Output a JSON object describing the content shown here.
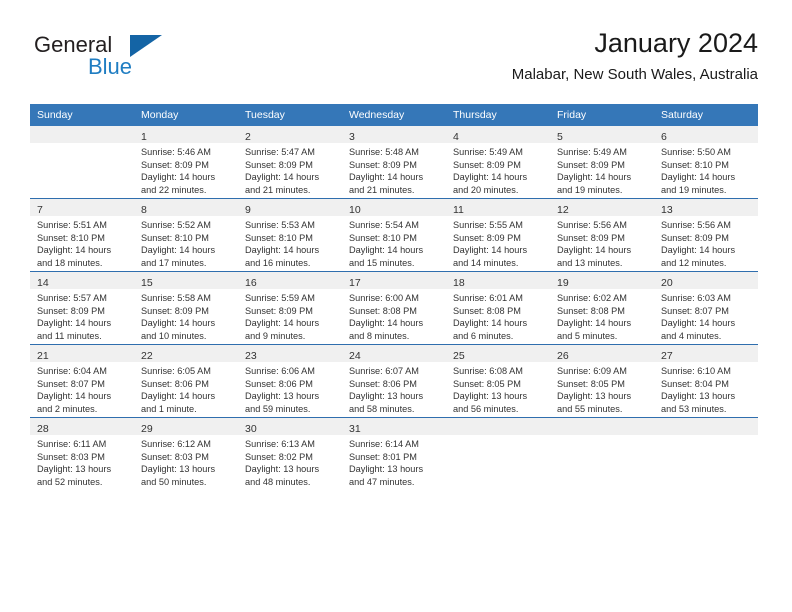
{
  "brand": {
    "word_general": "General",
    "word_blue": "Blue",
    "triangle_color": "#1464a5"
  },
  "header": {
    "title": "January 2024",
    "subtitle": "Malabar, New South Wales, Australia"
  },
  "theme": {
    "header_bg": "#3577b8",
    "daynum_bg": "#f0f0f0",
    "row_divider": "#2f6eae",
    "text": "#333333"
  },
  "weekdays": [
    "Sunday",
    "Monday",
    "Tuesday",
    "Wednesday",
    "Thursday",
    "Friday",
    "Saturday"
  ],
  "weeks": [
    [
      {
        "day": "",
        "sunrise": "",
        "sunset": "",
        "daylight1": "",
        "daylight2": ""
      },
      {
        "day": "1",
        "sunrise": "Sunrise: 5:46 AM",
        "sunset": "Sunset: 8:09 PM",
        "daylight1": "Daylight: 14 hours",
        "daylight2": "and 22 minutes."
      },
      {
        "day": "2",
        "sunrise": "Sunrise: 5:47 AM",
        "sunset": "Sunset: 8:09 PM",
        "daylight1": "Daylight: 14 hours",
        "daylight2": "and 21 minutes."
      },
      {
        "day": "3",
        "sunrise": "Sunrise: 5:48 AM",
        "sunset": "Sunset: 8:09 PM",
        "daylight1": "Daylight: 14 hours",
        "daylight2": "and 21 minutes."
      },
      {
        "day": "4",
        "sunrise": "Sunrise: 5:49 AM",
        "sunset": "Sunset: 8:09 PM",
        "daylight1": "Daylight: 14 hours",
        "daylight2": "and 20 minutes."
      },
      {
        "day": "5",
        "sunrise": "Sunrise: 5:49 AM",
        "sunset": "Sunset: 8:09 PM",
        "daylight1": "Daylight: 14 hours",
        "daylight2": "and 19 minutes."
      },
      {
        "day": "6",
        "sunrise": "Sunrise: 5:50 AM",
        "sunset": "Sunset: 8:10 PM",
        "daylight1": "Daylight: 14 hours",
        "daylight2": "and 19 minutes."
      }
    ],
    [
      {
        "day": "7",
        "sunrise": "Sunrise: 5:51 AM",
        "sunset": "Sunset: 8:10 PM",
        "daylight1": "Daylight: 14 hours",
        "daylight2": "and 18 minutes."
      },
      {
        "day": "8",
        "sunrise": "Sunrise: 5:52 AM",
        "sunset": "Sunset: 8:10 PM",
        "daylight1": "Daylight: 14 hours",
        "daylight2": "and 17 minutes."
      },
      {
        "day": "9",
        "sunrise": "Sunrise: 5:53 AM",
        "sunset": "Sunset: 8:10 PM",
        "daylight1": "Daylight: 14 hours",
        "daylight2": "and 16 minutes."
      },
      {
        "day": "10",
        "sunrise": "Sunrise: 5:54 AM",
        "sunset": "Sunset: 8:10 PM",
        "daylight1": "Daylight: 14 hours",
        "daylight2": "and 15 minutes."
      },
      {
        "day": "11",
        "sunrise": "Sunrise: 5:55 AM",
        "sunset": "Sunset: 8:09 PM",
        "daylight1": "Daylight: 14 hours",
        "daylight2": "and 14 minutes."
      },
      {
        "day": "12",
        "sunrise": "Sunrise: 5:56 AM",
        "sunset": "Sunset: 8:09 PM",
        "daylight1": "Daylight: 14 hours",
        "daylight2": "and 13 minutes."
      },
      {
        "day": "13",
        "sunrise": "Sunrise: 5:56 AM",
        "sunset": "Sunset: 8:09 PM",
        "daylight1": "Daylight: 14 hours",
        "daylight2": "and 12 minutes."
      }
    ],
    [
      {
        "day": "14",
        "sunrise": "Sunrise: 5:57 AM",
        "sunset": "Sunset: 8:09 PM",
        "daylight1": "Daylight: 14 hours",
        "daylight2": "and 11 minutes."
      },
      {
        "day": "15",
        "sunrise": "Sunrise: 5:58 AM",
        "sunset": "Sunset: 8:09 PM",
        "daylight1": "Daylight: 14 hours",
        "daylight2": "and 10 minutes."
      },
      {
        "day": "16",
        "sunrise": "Sunrise: 5:59 AM",
        "sunset": "Sunset: 8:09 PM",
        "daylight1": "Daylight: 14 hours",
        "daylight2": "and 9 minutes."
      },
      {
        "day": "17",
        "sunrise": "Sunrise: 6:00 AM",
        "sunset": "Sunset: 8:08 PM",
        "daylight1": "Daylight: 14 hours",
        "daylight2": "and 8 minutes."
      },
      {
        "day": "18",
        "sunrise": "Sunrise: 6:01 AM",
        "sunset": "Sunset: 8:08 PM",
        "daylight1": "Daylight: 14 hours",
        "daylight2": "and 6 minutes."
      },
      {
        "day": "19",
        "sunrise": "Sunrise: 6:02 AM",
        "sunset": "Sunset: 8:08 PM",
        "daylight1": "Daylight: 14 hours",
        "daylight2": "and 5 minutes."
      },
      {
        "day": "20",
        "sunrise": "Sunrise: 6:03 AM",
        "sunset": "Sunset: 8:07 PM",
        "daylight1": "Daylight: 14 hours",
        "daylight2": "and 4 minutes."
      }
    ],
    [
      {
        "day": "21",
        "sunrise": "Sunrise: 6:04 AM",
        "sunset": "Sunset: 8:07 PM",
        "daylight1": "Daylight: 14 hours",
        "daylight2": "and 2 minutes."
      },
      {
        "day": "22",
        "sunrise": "Sunrise: 6:05 AM",
        "sunset": "Sunset: 8:06 PM",
        "daylight1": "Daylight: 14 hours",
        "daylight2": "and 1 minute."
      },
      {
        "day": "23",
        "sunrise": "Sunrise: 6:06 AM",
        "sunset": "Sunset: 8:06 PM",
        "daylight1": "Daylight: 13 hours",
        "daylight2": "and 59 minutes."
      },
      {
        "day": "24",
        "sunrise": "Sunrise: 6:07 AM",
        "sunset": "Sunset: 8:06 PM",
        "daylight1": "Daylight: 13 hours",
        "daylight2": "and 58 minutes."
      },
      {
        "day": "25",
        "sunrise": "Sunrise: 6:08 AM",
        "sunset": "Sunset: 8:05 PM",
        "daylight1": "Daylight: 13 hours",
        "daylight2": "and 56 minutes."
      },
      {
        "day": "26",
        "sunrise": "Sunrise: 6:09 AM",
        "sunset": "Sunset: 8:05 PM",
        "daylight1": "Daylight: 13 hours",
        "daylight2": "and 55 minutes."
      },
      {
        "day": "27",
        "sunrise": "Sunrise: 6:10 AM",
        "sunset": "Sunset: 8:04 PM",
        "daylight1": "Daylight: 13 hours",
        "daylight2": "and 53 minutes."
      }
    ],
    [
      {
        "day": "28",
        "sunrise": "Sunrise: 6:11 AM",
        "sunset": "Sunset: 8:03 PM",
        "daylight1": "Daylight: 13 hours",
        "daylight2": "and 52 minutes."
      },
      {
        "day": "29",
        "sunrise": "Sunrise: 6:12 AM",
        "sunset": "Sunset: 8:03 PM",
        "daylight1": "Daylight: 13 hours",
        "daylight2": "and 50 minutes."
      },
      {
        "day": "30",
        "sunrise": "Sunrise: 6:13 AM",
        "sunset": "Sunset: 8:02 PM",
        "daylight1": "Daylight: 13 hours",
        "daylight2": "and 48 minutes."
      },
      {
        "day": "31",
        "sunrise": "Sunrise: 6:14 AM",
        "sunset": "Sunset: 8:01 PM",
        "daylight1": "Daylight: 13 hours",
        "daylight2": "and 47 minutes."
      },
      {
        "day": "",
        "sunrise": "",
        "sunset": "",
        "daylight1": "",
        "daylight2": ""
      },
      {
        "day": "",
        "sunrise": "",
        "sunset": "",
        "daylight1": "",
        "daylight2": ""
      },
      {
        "day": "",
        "sunrise": "",
        "sunset": "",
        "daylight1": "",
        "daylight2": ""
      }
    ]
  ]
}
